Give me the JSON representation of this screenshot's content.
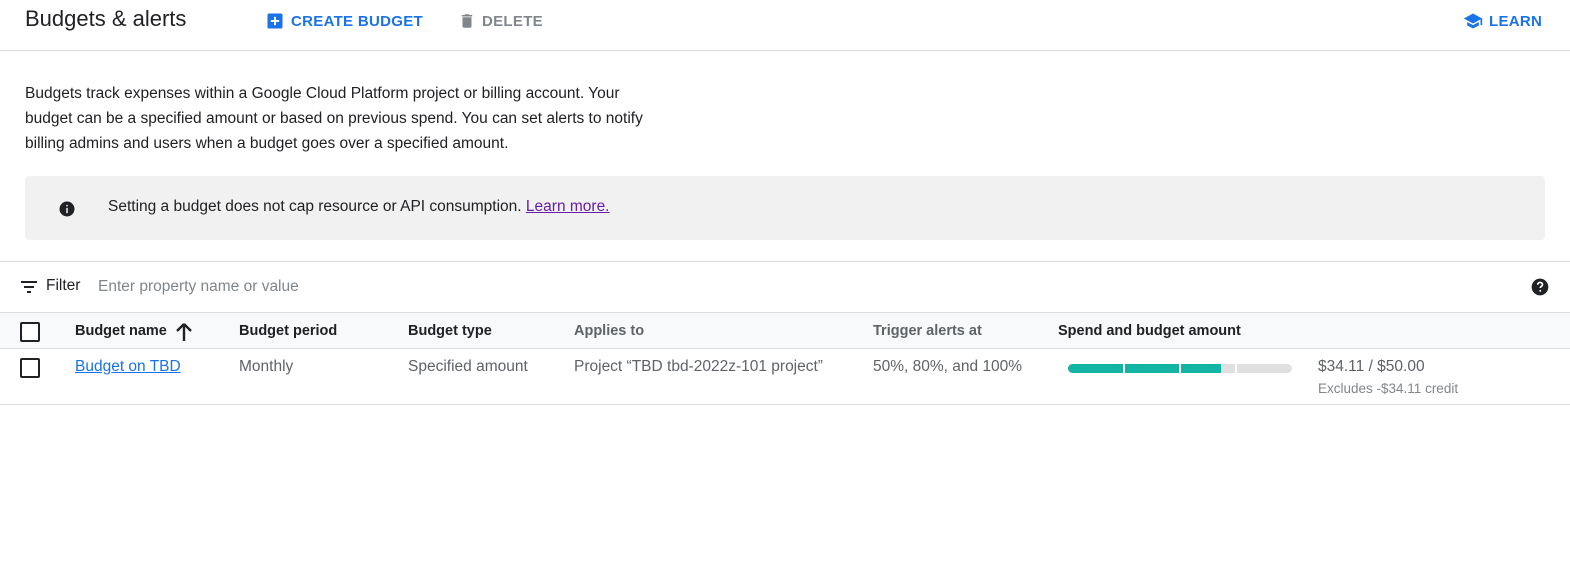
{
  "header": {
    "title": "Budgets & alerts",
    "create_label": "CREATE BUDGET",
    "delete_label": "DELETE",
    "learn_label": "LEARN",
    "accent_color": "#1a73e8"
  },
  "description": "Budgets track expenses within a Google Cloud Platform project or billing account. Your budget can be a specified amount or based on previous spend. You can set alerts to notify billing admins and users when a budget goes over a specified amount.",
  "info_banner": {
    "icon": "info-icon",
    "text": "Setting a budget does not cap resource or API consumption.",
    "link_text": "Learn more."
  },
  "filter": {
    "icon": "filter-icon",
    "label": "Filter",
    "placeholder": "Enter property name or value",
    "help_icon": "help-icon"
  },
  "table": {
    "columns": {
      "budget_name": "Budget name",
      "budget_period": "Budget period",
      "budget_type": "Budget type",
      "applies_to": "Applies to",
      "trigger_alerts": "Trigger alerts at",
      "spend_amount": "Spend and budget amount"
    },
    "sort_icon": "arrow-upward-icon",
    "rows": [
      {
        "name": "Budget on TBD",
        "period": "Monthly",
        "type": "Specified amount",
        "applies_to": "Project “TBD tbd-2022z-101 project”",
        "trigger": "50%, 80%, and 100%",
        "spend_fraction": 0.682,
        "progress_color": "#12b5a5",
        "threshold_fractions": [
          0.25,
          0.5,
          0.75
        ],
        "amount": "$34.11 / $50.00",
        "credit": "Excludes -$34.11 credit"
      }
    ]
  }
}
